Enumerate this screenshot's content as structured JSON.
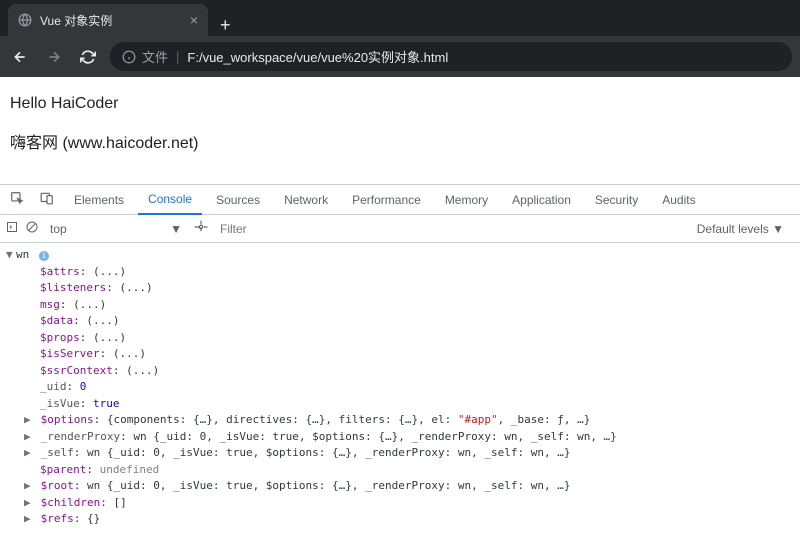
{
  "tab": {
    "title": "Vue 对象实例"
  },
  "url": {
    "info_label": "文件",
    "path": "F:/vue_workspace/vue/vue%20实例对象.html"
  },
  "page": {
    "line1": "Hello HaiCoder",
    "line2": "嗨客网  (www.haicoder.net)"
  },
  "devtools": {
    "tabs": {
      "elements": "Elements",
      "console": "Console",
      "sources": "Sources",
      "network": "Network",
      "performance": "Performance",
      "memory": "Memory",
      "application": "Application",
      "security": "Security",
      "audits": "Audits"
    },
    "filter": {
      "context": "top",
      "filter_placeholder": "Filter",
      "levels": "Default levels"
    },
    "console": {
      "obj_name": "wn",
      "props": {
        "attrs": "$attrs",
        "attrs_v": "(...)",
        "listeners": "$listeners",
        "listeners_v": "(...)",
        "msg": "msg",
        "msg_v": "(...)",
        "data": "$data",
        "data_v": "(...)",
        "props": "$props",
        "props_v": "(...)",
        "isserver": "$isServer",
        "isserver_v": "(...)",
        "ssrcontext": "$ssrContext",
        "ssrcontext_v": "(...)",
        "uid": "_uid",
        "uid_v": "0",
        "isvue": "_isVue",
        "isvue_v": "true",
        "options": "$options",
        "options_v": "{components: {…}, directives: {…}, filters: {…}, el: ",
        "options_el": "\"#app\"",
        "options_v2": ", _base: ƒ, …}",
        "renderproxy": "_renderProxy",
        "renderproxy_v": "wn {_uid: 0, _isVue: true, $options: {…}, _renderProxy: wn, _self: wn, …}",
        "self": "_self",
        "self_v": "wn {_uid: 0, _isVue: true, $options: {…}, _renderProxy: wn, _self: wn, …}",
        "parent": "$parent",
        "parent_v": "undefined",
        "root": "$root",
        "root_v": "wn {_uid: 0, _isVue: true, $options: {…}, _renderProxy: wn, _self: wn, …}",
        "children": "$children",
        "children_v": "[]",
        "refs": "$refs",
        "refs_v": "{}"
      }
    }
  }
}
